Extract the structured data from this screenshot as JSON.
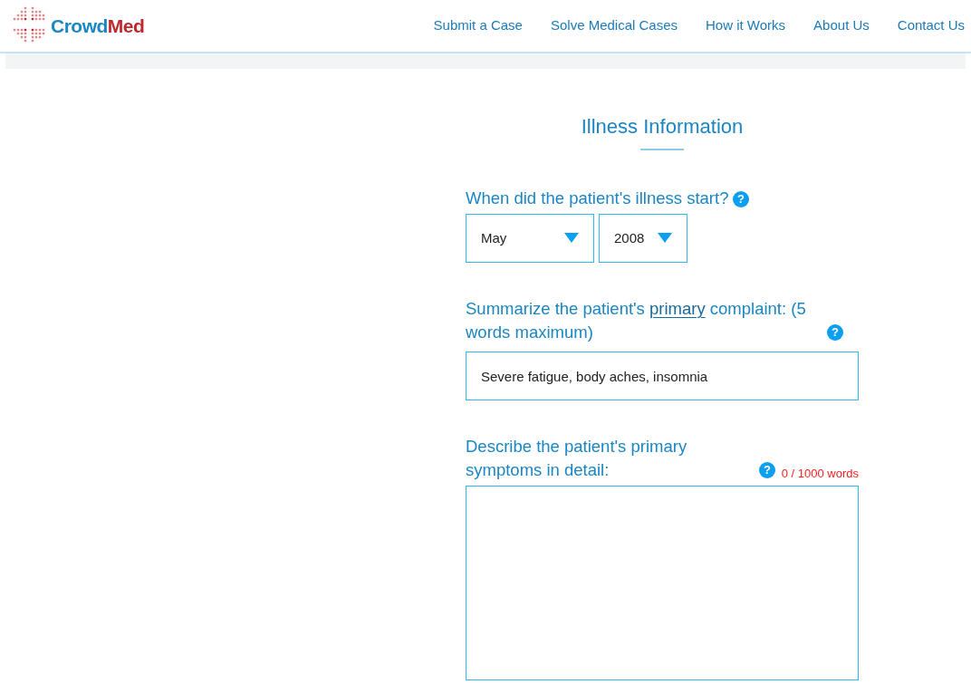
{
  "brand": {
    "first": "Crowd",
    "second": "Med"
  },
  "nav": [
    {
      "label": "Submit a Case"
    },
    {
      "label": "Solve Medical Cases"
    },
    {
      "label": "How it Works"
    },
    {
      "label": "About Us"
    },
    {
      "label": "Contact Us"
    }
  ],
  "section_title": "Illness Information",
  "help": "?",
  "start_question": {
    "label": "When did the patient's illness start?",
    "month": "May",
    "year": "2008"
  },
  "complaint": {
    "label_before": "Summarize the patient's ",
    "label_underlined": "primary",
    "label_after": " complaint: (5 words maximum)",
    "value": "Severe fatigue, body aches, insomnia"
  },
  "symptoms": {
    "label": "Describe the patient's primary symptoms in detail:",
    "counter": "0 / 1000 words"
  }
}
